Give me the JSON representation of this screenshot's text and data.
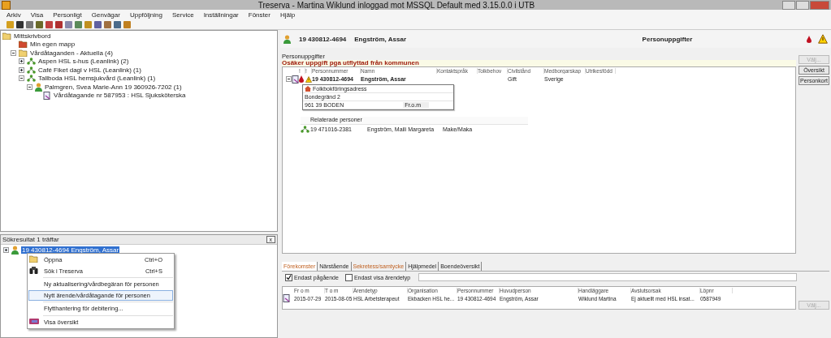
{
  "window": {
    "title": "Treserva - Martina Wiklund inloggad mot MSSQL Default  med 3.15.0.0 i UTB"
  },
  "menu": [
    "Arkiv",
    "Visa",
    "Personligt",
    "Genvägar",
    "Uppföljning",
    "Service",
    "Inställningar",
    "Fönster",
    "Hjälp"
  ],
  "tree": [
    {
      "label": "Mittskrivbord",
      "kind": "folder",
      "children": [
        {
          "label": "Min egen mapp",
          "kind": "mapp"
        },
        {
          "label": "Vårdåtaganden - Aktuella (4)",
          "kind": "folder",
          "expanded": true,
          "children": [
            {
              "label": "Aspen HSL s-hus (Leanlink) (2)",
              "kind": "unit",
              "expanded": false
            },
            {
              "label": "Café Fiket dagl v HSL  (Leanlink) (1)",
              "kind": "unit",
              "expanded": false
            },
            {
              "label": "Tallboda HSL hemsjukvård (Leanlink) (1)",
              "kind": "unit",
              "expanded": true,
              "children": [
                {
                  "label": "Palmgren, Svea Marie-Ann  19 360926-7202 (1)",
                  "kind": "person",
                  "expanded": true,
                  "children": [
                    {
                      "label": "Vårdåtagande nr 587953 : HSL Sjuksköterska",
                      "kind": "task"
                    }
                  ]
                }
              ]
            }
          ]
        }
      ]
    }
  ],
  "search": {
    "title": "Sökresultat 1 träffar",
    "close": "x",
    "results": [
      {
        "label": "19 430812-4694 Engström, Assar",
        "selected": true
      }
    ]
  },
  "context_menu": [
    {
      "label": "Öppna",
      "shortcut": "Ctrl+O",
      "separator_before": false,
      "selected": false
    },
    {
      "label": "Sök i Treserva",
      "shortcut": "Ctrl+S",
      "separator_before": false,
      "selected": false
    },
    {
      "label": "Ny aktualisering/vårdbegäran för personen",
      "separator_before": true,
      "selected": false
    },
    {
      "label": "Nytt ärende/vårdåtagande för personen",
      "separator_before": false,
      "selected": true
    },
    {
      "label": "Flytthantering för debitering...",
      "separator_before": true,
      "selected": false
    },
    {
      "label": "Visa översikt",
      "separator_before": true,
      "selected": false
    }
  ],
  "header": {
    "personnummer": "19 430812-4694",
    "name": "Engström, Assar",
    "section": "Personuppgifter"
  },
  "person_panel": {
    "label": "Personuppgifter",
    "warning": "Osäker uppgift pga utflyttad från kommunen",
    "columns": [
      "!",
      "!",
      "Personnummer",
      "Namn",
      "Kontaktspråk",
      "Tolkbehov",
      "Civilstånd",
      "Medborgarskap",
      "Utrikesfödd"
    ],
    "row": {
      "expanded": true,
      "cells": [
        "",
        "",
        "19 430812-4694",
        "Engström, Assar",
        "",
        "",
        "Gift",
        "Sverige",
        ""
      ]
    },
    "address": {
      "title": "Folkbokföringsadress",
      "street": "Bondegränd 2",
      "city": "961 39  BODEN",
      "from_label": "Fr.o.m"
    },
    "related": {
      "title": "Relaterade personer",
      "rows": [
        {
          "personnummer": "19 471016-2381",
          "name": "Engström, Maili Margareta",
          "relation": "Make/Maka"
        }
      ]
    }
  },
  "side_buttons": [
    {
      "label": "Välj...",
      "disabled": true
    },
    {
      "label": "Översikt",
      "disabled": false
    },
    {
      "label": "Personkort",
      "disabled": false
    }
  ],
  "tabs": [
    {
      "label": "Förekomster",
      "selected": true,
      "flagged": true
    },
    {
      "label": "Närstående",
      "selected": false,
      "flagged": false
    },
    {
      "label": "Sekretess/samtycke",
      "selected": false,
      "flagged": true
    },
    {
      "label": "Hjälpmedel",
      "selected": false,
      "flagged": false
    },
    {
      "label": "Boendeöversikt",
      "selected": false,
      "flagged": false
    }
  ],
  "filters": [
    {
      "label": "Endast pågående",
      "checked": true
    },
    {
      "label": "Endast visa ärendetyp",
      "checked": false
    }
  ],
  "cases": {
    "columns": [
      "Fr o m",
      "T o m",
      "Ärendetyp",
      "Organisation",
      "Personnummer",
      "Huvudperson",
      "Handläggare",
      "Avslutsorsak",
      "Löpnr"
    ],
    "rows": [
      [
        "2015-07-29",
        "2015-08-05",
        "HSL Arbetsterapeut",
        "Ekbacken HSL he...",
        "19 430812-4694",
        "Engström, Assar",
        "Wiklund Martina",
        "Ej aktuellt med HSL insat...",
        "0587949"
      ]
    ]
  },
  "bottom_button": {
    "label": "Välj...",
    "disabled": true
  }
}
